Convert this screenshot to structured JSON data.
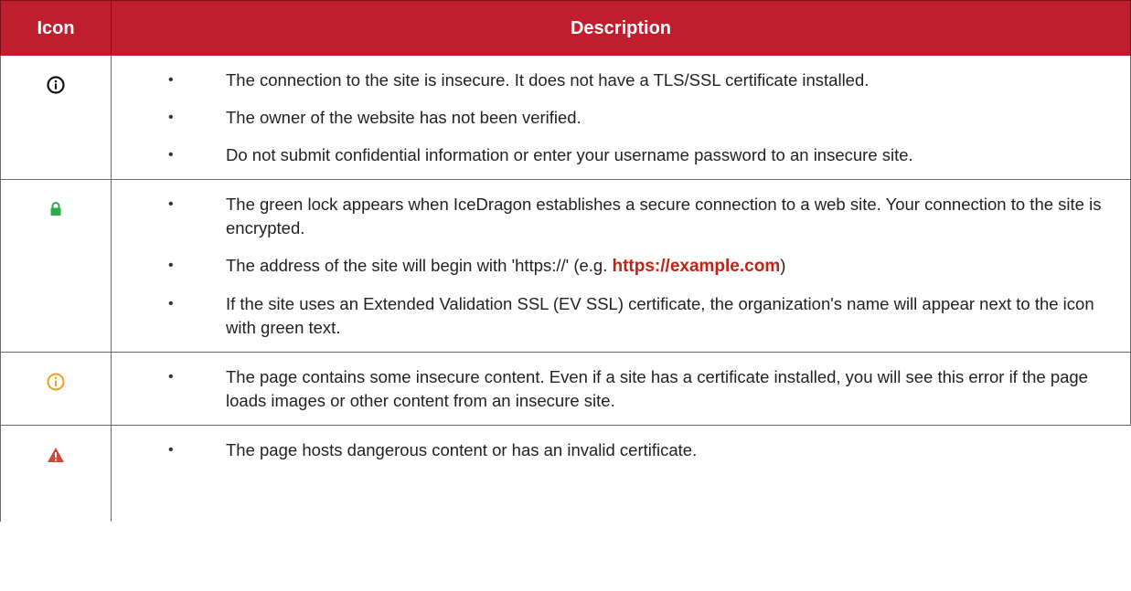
{
  "table": {
    "headers": {
      "icon": "Icon",
      "description": "Description"
    },
    "rows": [
      {
        "icon": "info-circle-icon",
        "icon_color": "#111111",
        "bullets": [
          "The connection to the site is insecure. It does not have a TLS/SSL certificate installed.",
          "The owner of the website has not been verified.",
          "Do not submit confidential information or enter your username password to an insecure site."
        ]
      },
      {
        "icon": "green-lock-icon",
        "icon_color": "#2eaa4e",
        "bullets": [
          "The green lock appears when IceDragon establishes a secure connection to a web site. Your connection to the site is encrypted.",
          {
            "prefix": "The address of the site will begin with 'https://' (e.g. ",
            "link": "https://example.com",
            "suffix": ")"
          },
          "If the site uses an Extended Validation SSL (EV SSL) certificate, the organization's name will appear next to the icon with green text."
        ]
      },
      {
        "icon": "warning-info-circle-icon",
        "icon_color": "#f0a020",
        "bullets": [
          "The page contains some insecure content. Even if a site has a certificate installed, you will see this error if the page loads images or other content from an insecure site."
        ]
      },
      {
        "icon": "danger-triangle-icon",
        "icon_color": "#d4453a",
        "bullets": [
          "The page hosts dangerous content or has an invalid certificate."
        ]
      }
    ]
  },
  "colors": {
    "header_bg": "#bf1e2e",
    "header_text": "#ffffff",
    "link": "#c8200f"
  }
}
